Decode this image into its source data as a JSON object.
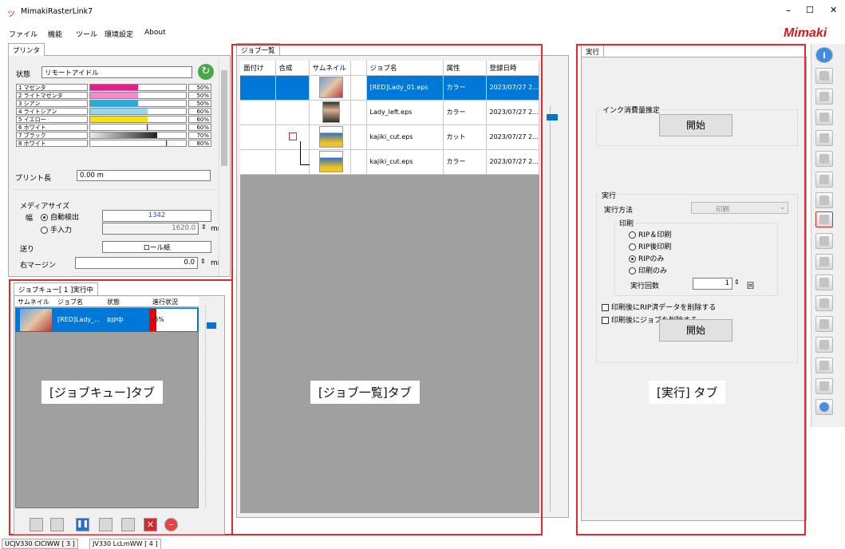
{
  "window": {
    "title": "MimakiRasterLink7",
    "logo": "Mimaki",
    "controls": [
      "–",
      "☐",
      "✕"
    ]
  },
  "menu": [
    "ファイル",
    "機能",
    "ツール",
    "環境設定",
    "About"
  ],
  "printer": {
    "tab": "プリンタ",
    "status_label": "状態",
    "status_value": "リモートアイドル",
    "inks": [
      {
        "name": "1 マゼンタ",
        "pct": "50%",
        "color": "#e0208c",
        "level": 0.5
      },
      {
        "name": "2 ライトマゼンタ",
        "pct": "50%",
        "color": "#f08ccc",
        "level": 0.5
      },
      {
        "name": "3 シアン",
        "pct": "50%",
        "color": "#24aee0",
        "level": 0.5
      },
      {
        "name": "4 ライトシアン",
        "pct": "60%",
        "color": "#96d6f0",
        "level": 0.6
      },
      {
        "name": "5 イエロー",
        "pct": "60%",
        "color": "#f6e01a",
        "level": 0.6
      },
      {
        "name": "6 ホワイト",
        "pct": "60%",
        "color": "#ffffff",
        "level": 0.6
      },
      {
        "name": "7 ブラック",
        "pct": "70%",
        "color": "#303030",
        "level": 0.7
      },
      {
        "name": "8 ホワイト",
        "pct": "80%",
        "color": "#ffffff",
        "level": 0.8
      }
    ],
    "print_length_label": "プリント長",
    "print_length_value": "0.00 m",
    "media_size_label": "メディアサイズ",
    "width_label": "幅",
    "auto_detect_label": "自動検出",
    "manual_label": "手入力",
    "width_value": "1342",
    "manual_value": "1620.0",
    "unit_mm": "mm",
    "feed_label": "送り",
    "feed_value": "ロール紙",
    "right_margin_label": "右マージン",
    "right_margin_value": "0.0"
  },
  "queue": {
    "tab": "ジョブキュー[ 1 ]実行中",
    "columns": [
      "サムネイル",
      "ジョブ名",
      "状態",
      "進行状況"
    ],
    "rows": [
      {
        "name": "[RED]Lady_...",
        "state": "RIP中",
        "progress": "15%",
        "level": 0.15
      }
    ],
    "caption": "[ジョブキュー]タブ"
  },
  "joblist": {
    "tab": "ジョブ一覧",
    "columns": [
      "面付け",
      "合成",
      "サムネイル",
      "",
      "ジョブ名",
      "属性",
      "登録日時"
    ],
    "rows": [
      {
        "name": "[RED]Lady_01.eps",
        "attr": "カラー",
        "date": "2023/07/27 2..."
      },
      {
        "name": "Lady_left.eps",
        "attr": "カラー",
        "date": "2023/07/27 2..."
      },
      {
        "name": "kajiki_cut.eps",
        "attr": "カット",
        "date": "2023/07/27 2..."
      },
      {
        "name": "kajiki_cut.eps",
        "attr": "カラー",
        "date": "2023/07/27 2..."
      }
    ],
    "caption": "[ジョブ一覧]タブ"
  },
  "execute": {
    "tab": "実行",
    "ink_estimate_label": "インク消費量推定",
    "start_label": "開始",
    "exec_group_label": "実行",
    "method_label": "実行方法",
    "method_value": "印刷",
    "print_group_label": "印刷",
    "options": [
      "RIP＆印刷",
      "RIP後印刷",
      "RIPのみ",
      "印刷のみ"
    ],
    "selected": "RIPのみ",
    "count_label": "実行回数",
    "count_value": "1",
    "count_unit": "回",
    "check1": "印刷後にRIP済データを削除する",
    "check2": "印刷後にジョブを削除する",
    "start2_label": "開始",
    "caption": "[実行] タブ"
  },
  "status_tabs": [
    "UCJV330 CICIWW [ 3 ]",
    "JV330 LcLmWW [ 4 ]"
  ]
}
